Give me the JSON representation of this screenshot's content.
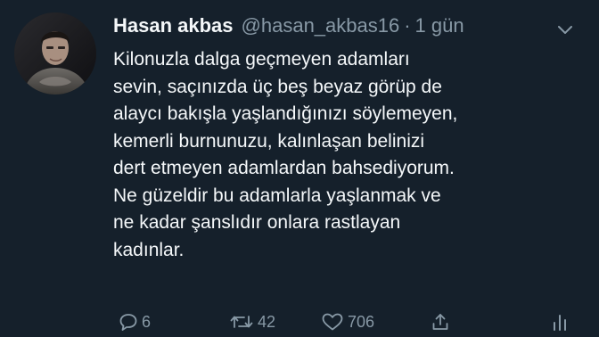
{
  "tweet": {
    "display_name": "Hasan akbas",
    "handle": "@hasan_akbas16",
    "separator": "·",
    "time": "1 gün",
    "text_lines": [
      "Kilonuzla dalga geçmeyen adamları",
      "sevin, saçınızda üç beş beyaz görüp de",
      "alaycı bakışla yaşlandığınızı söylemeyen,",
      "kemerli burnunuzu, kalınlaşan belinizi",
      "dert etmeyen adamlardan bahsediyorum.",
      "Ne güzeldir bu adamlarla yaşlanmak ve",
      "ne kadar şanslıdır onlara rastlayan",
      "kadınlar."
    ]
  },
  "actions": {
    "reply_count": "6",
    "retweet_count": "42",
    "like_count": "706"
  },
  "icons": {
    "reply": "reply-icon",
    "retweet": "retweet-icon",
    "like": "like-icon",
    "share": "share-icon",
    "analytics": "analytics-icon",
    "more": "chevron-down-icon"
  },
  "colors": {
    "background": "#15202b",
    "primary_text": "#f5f8fa",
    "secondary_text": "#8899a6"
  }
}
